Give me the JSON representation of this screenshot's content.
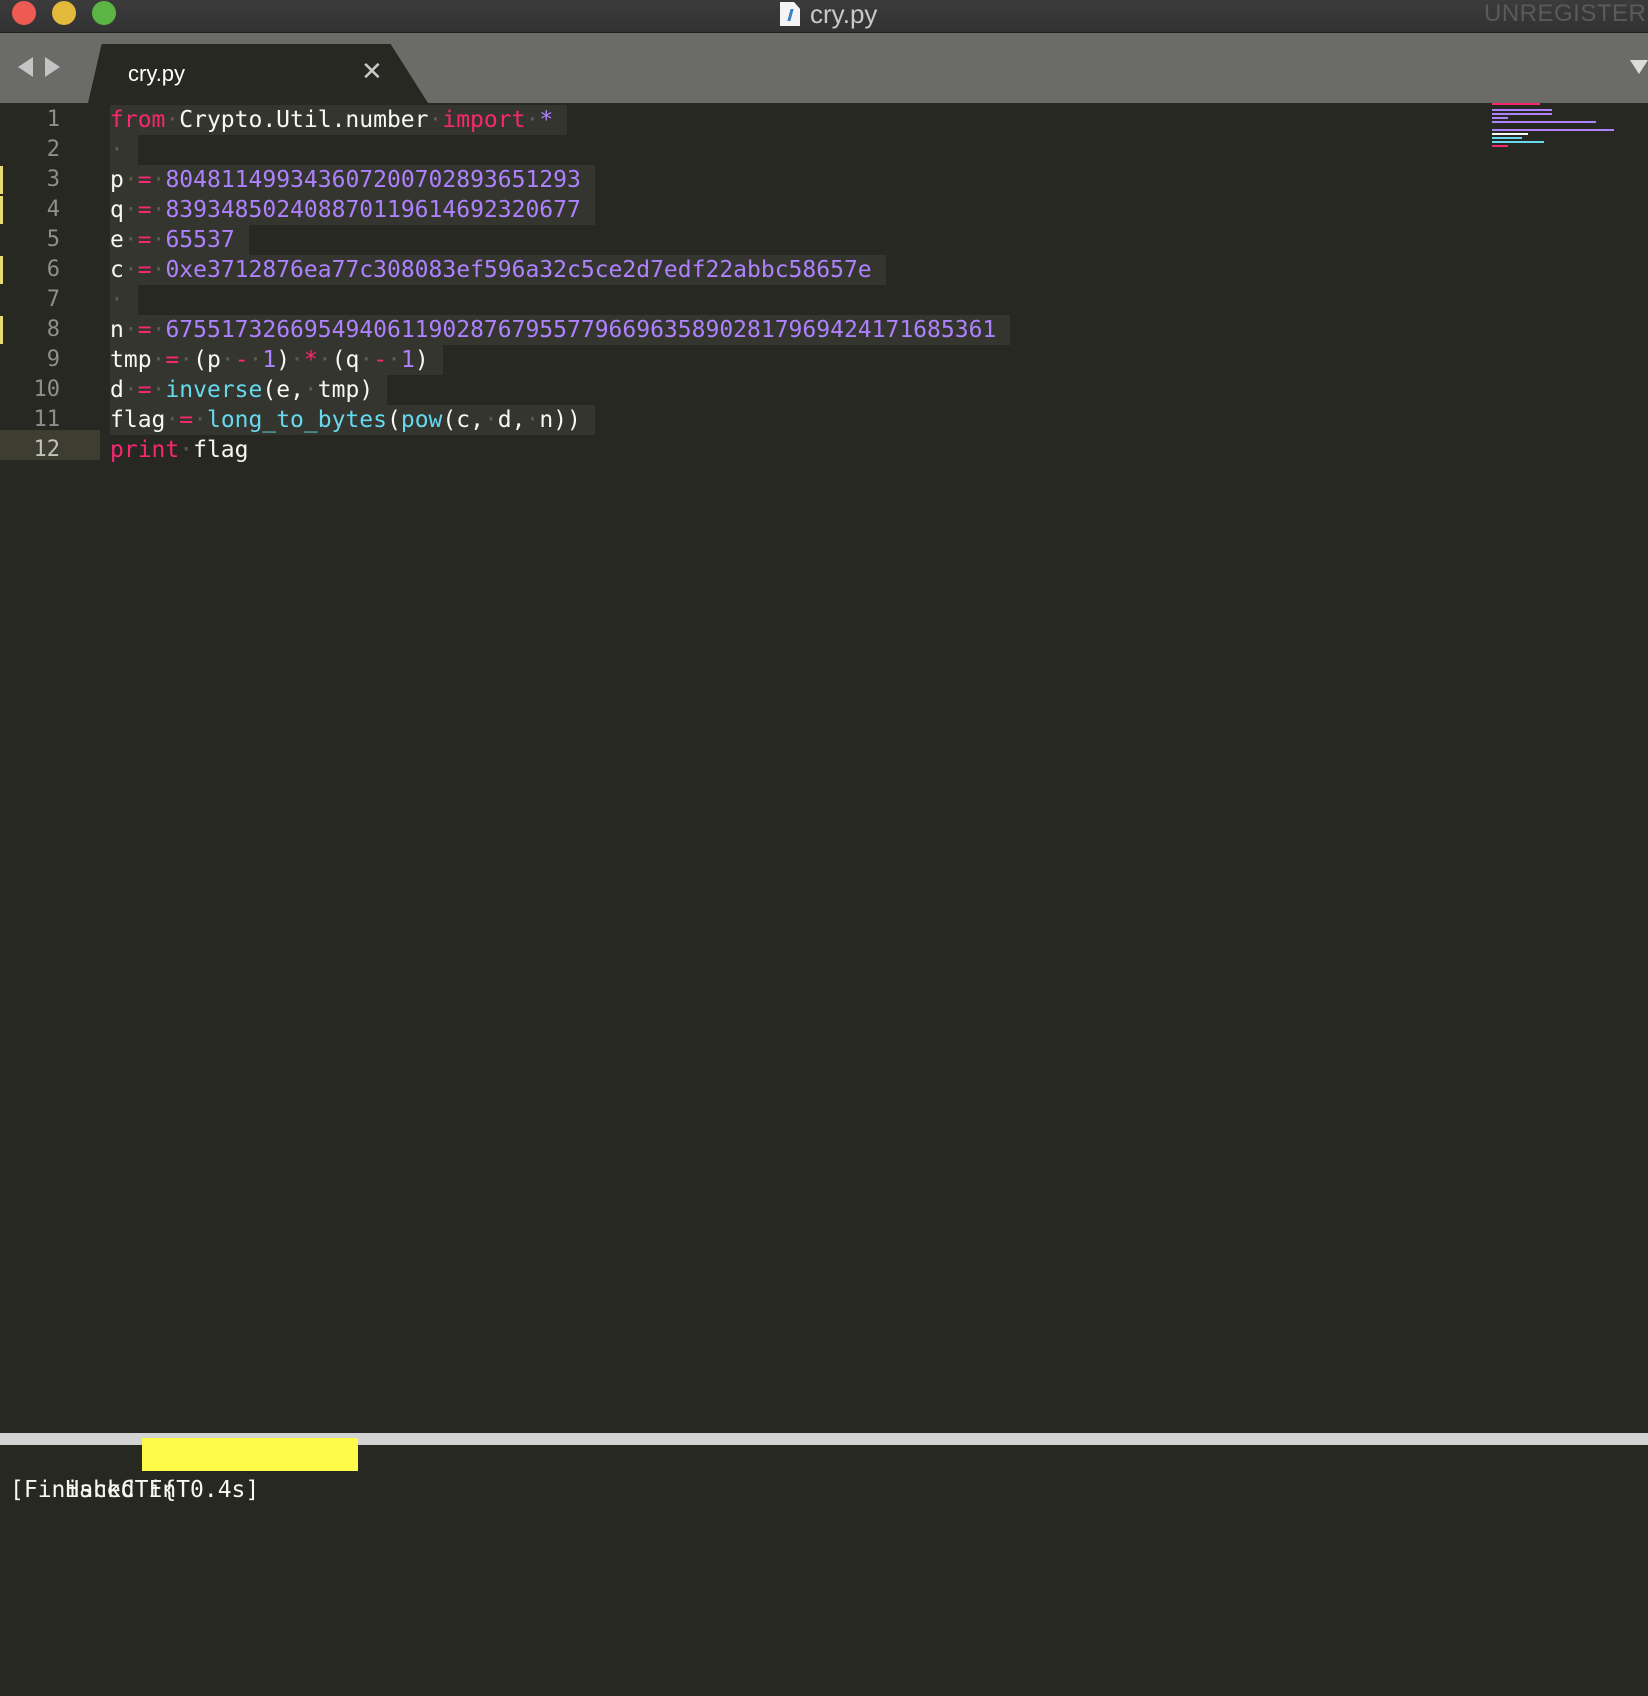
{
  "window": {
    "title": "cry.py",
    "unregistered": "UNREGISTERED"
  },
  "tabs": [
    {
      "label": "cry.py",
      "close": "✕"
    }
  ],
  "editor": {
    "line_numbers": [
      "1",
      "2",
      "3",
      "4",
      "5",
      "6",
      "7",
      "8",
      "9",
      "10",
      "11",
      "12"
    ],
    "current_line": "12",
    "modified_lines": [
      "3",
      "4",
      "6",
      "8"
    ],
    "lines": [
      [
        {
          "t": "from",
          "c": "kw"
        },
        {
          "t": "·",
          "c": "ws"
        },
        {
          "t": "Crypto.Util.number",
          "c": "id"
        },
        {
          "t": "·",
          "c": "ws"
        },
        {
          "t": "import",
          "c": "kw"
        },
        {
          "t": "·",
          "c": "ws"
        },
        {
          "t": "*",
          "c": "num"
        }
      ],
      [
        {
          "t": "·",
          "c": "ws"
        }
      ],
      [
        {
          "t": "p",
          "c": "id"
        },
        {
          "t": "·",
          "c": "ws"
        },
        {
          "t": "=",
          "c": "kw"
        },
        {
          "t": "·",
          "c": "ws"
        },
        {
          "t": "80481149934360720070289365129З",
          "c": "num"
        }
      ],
      [
        {
          "t": "q",
          "c": "id"
        },
        {
          "t": "·",
          "c": "ws"
        },
        {
          "t": "=",
          "c": "kw"
        },
        {
          "t": "·",
          "c": "ws"
        },
        {
          "t": "83934850240887011961469232067 7",
          "c": "num"
        }
      ],
      [
        {
          "t": "e",
          "c": "id"
        },
        {
          "t": "·",
          "c": "ws"
        },
        {
          "t": "=",
          "c": "kw"
        },
        {
          "t": "·",
          "c": "ws"
        },
        {
          "t": "65537",
          "c": "num"
        }
      ],
      [
        {
          "t": "c",
          "c": "id"
        },
        {
          "t": "·",
          "c": "ws"
        },
        {
          "t": "=",
          "c": "kw"
        },
        {
          "t": "·",
          "c": "ws"
        },
        {
          "t": "0xe3712876ea77c308083ef596a32c5ce2d7edf22abbc58657e",
          "c": "num"
        }
      ],
      [
        {
          "t": "·",
          "c": "ws"
        }
      ],
      [
        {
          "t": "n",
          "c": "id"
        },
        {
          "t": "·",
          "c": "ws"
        },
        {
          "t": "=",
          "c": "kw"
        },
        {
          "t": "·",
          "c": "ws"
        },
        {
          "t": "675517326695494061190287679557796696358902817969424171685361",
          "c": "num"
        }
      ],
      [
        {
          "t": "tmp",
          "c": "id"
        },
        {
          "t": "·",
          "c": "ws"
        },
        {
          "t": "=",
          "c": "kw"
        },
        {
          "t": "·",
          "c": "ws"
        },
        {
          "t": "(p",
          "c": "id"
        },
        {
          "t": "·",
          "c": "ws"
        },
        {
          "t": "-",
          "c": "kw"
        },
        {
          "t": "·",
          "c": "ws"
        },
        {
          "t": "1",
          "c": "num"
        },
        {
          "t": ")",
          "c": "id"
        },
        {
          "t": "·",
          "c": "ws"
        },
        {
          "t": "*",
          "c": "kw"
        },
        {
          "t": "·",
          "c": "ws"
        },
        {
          "t": "(q",
          "c": "id"
        },
        {
          "t": "·",
          "c": "ws"
        },
        {
          "t": "-",
          "c": "kw"
        },
        {
          "t": "·",
          "c": "ws"
        },
        {
          "t": "1",
          "c": "num"
        },
        {
          "t": ")",
          "c": "id"
        }
      ],
      [
        {
          "t": "d",
          "c": "id"
        },
        {
          "t": "·",
          "c": "ws"
        },
        {
          "t": "=",
          "c": "kw"
        },
        {
          "t": "·",
          "c": "ws"
        },
        {
          "t": "inverse",
          "c": "fn"
        },
        {
          "t": "(e,",
          "c": "id"
        },
        {
          "t": "·",
          "c": "ws"
        },
        {
          "t": "tmp)",
          "c": "id"
        }
      ],
      [
        {
          "t": "flag",
          "c": "id"
        },
        {
          "t": "·",
          "c": "ws"
        },
        {
          "t": "=",
          "c": "kw"
        },
        {
          "t": "·",
          "c": "ws"
        },
        {
          "t": "long_to_bytes",
          "c": "fn"
        },
        {
          "t": "(",
          "c": "id"
        },
        {
          "t": "pow",
          "c": "fn"
        },
        {
          "t": "(c,",
          "c": "id"
        },
        {
          "t": "·",
          "c": "ws"
        },
        {
          "t": "d,",
          "c": "id"
        },
        {
          "t": "·",
          "c": "ws"
        },
        {
          "t": "n))",
          "c": "id"
        }
      ],
      [
        {
          "t": "print",
          "c": "kw"
        },
        {
          "t": "·",
          "c": "ws"
        },
        {
          "t": "flag",
          "c": "id"
        }
      ]
    ]
  },
  "output": {
    "flag_prefix": "HackCTF{T",
    "finished": "[Finished in 0.4s]"
  },
  "colors": {
    "background": "#272822",
    "keyword": "#f92672",
    "number": "#ae81ff",
    "function": "#66d9ef",
    "text": "#f8f8f2",
    "redaction": "#fdfb47"
  }
}
